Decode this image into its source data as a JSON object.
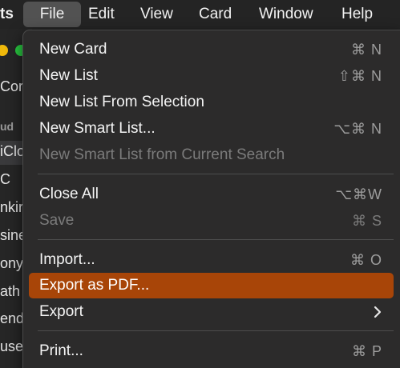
{
  "menubar": {
    "items": [
      {
        "label": "ts"
      },
      {
        "label": "File"
      },
      {
        "label": "Edit"
      },
      {
        "label": "View"
      },
      {
        "label": "Card"
      },
      {
        "label": "Window"
      },
      {
        "label": "Help"
      }
    ]
  },
  "background_window": {
    "traffic_colors": [
      "#f0b90b",
      "#28c840"
    ],
    "lines": [
      "Cor",
      "ud",
      "iClo",
      "C",
      "nkir",
      "sine",
      "ony",
      "ath",
      "end",
      "use"
    ]
  },
  "file_menu": {
    "items": [
      {
        "label": "New Card",
        "shortcut": "⌘ N"
      },
      {
        "label": "New List",
        "shortcut": "⇧⌘ N"
      },
      {
        "label": "New List From Selection",
        "shortcut": ""
      },
      {
        "label": "New Smart List...",
        "shortcut": "⌥⌘ N"
      },
      {
        "label": "New Smart List from Current Search",
        "shortcut": ""
      },
      {
        "label": "Close All",
        "shortcut": "⌥⌘W"
      },
      {
        "label": "Save",
        "shortcut": "⌘ S"
      },
      {
        "label": "Import...",
        "shortcut": "⌘ O"
      },
      {
        "label": "Export as PDF...",
        "shortcut": ""
      },
      {
        "label": "Export",
        "shortcut": ""
      },
      {
        "label": "Print...",
        "shortcut": "⌘ P"
      }
    ],
    "highlight_color": "#a84508"
  }
}
